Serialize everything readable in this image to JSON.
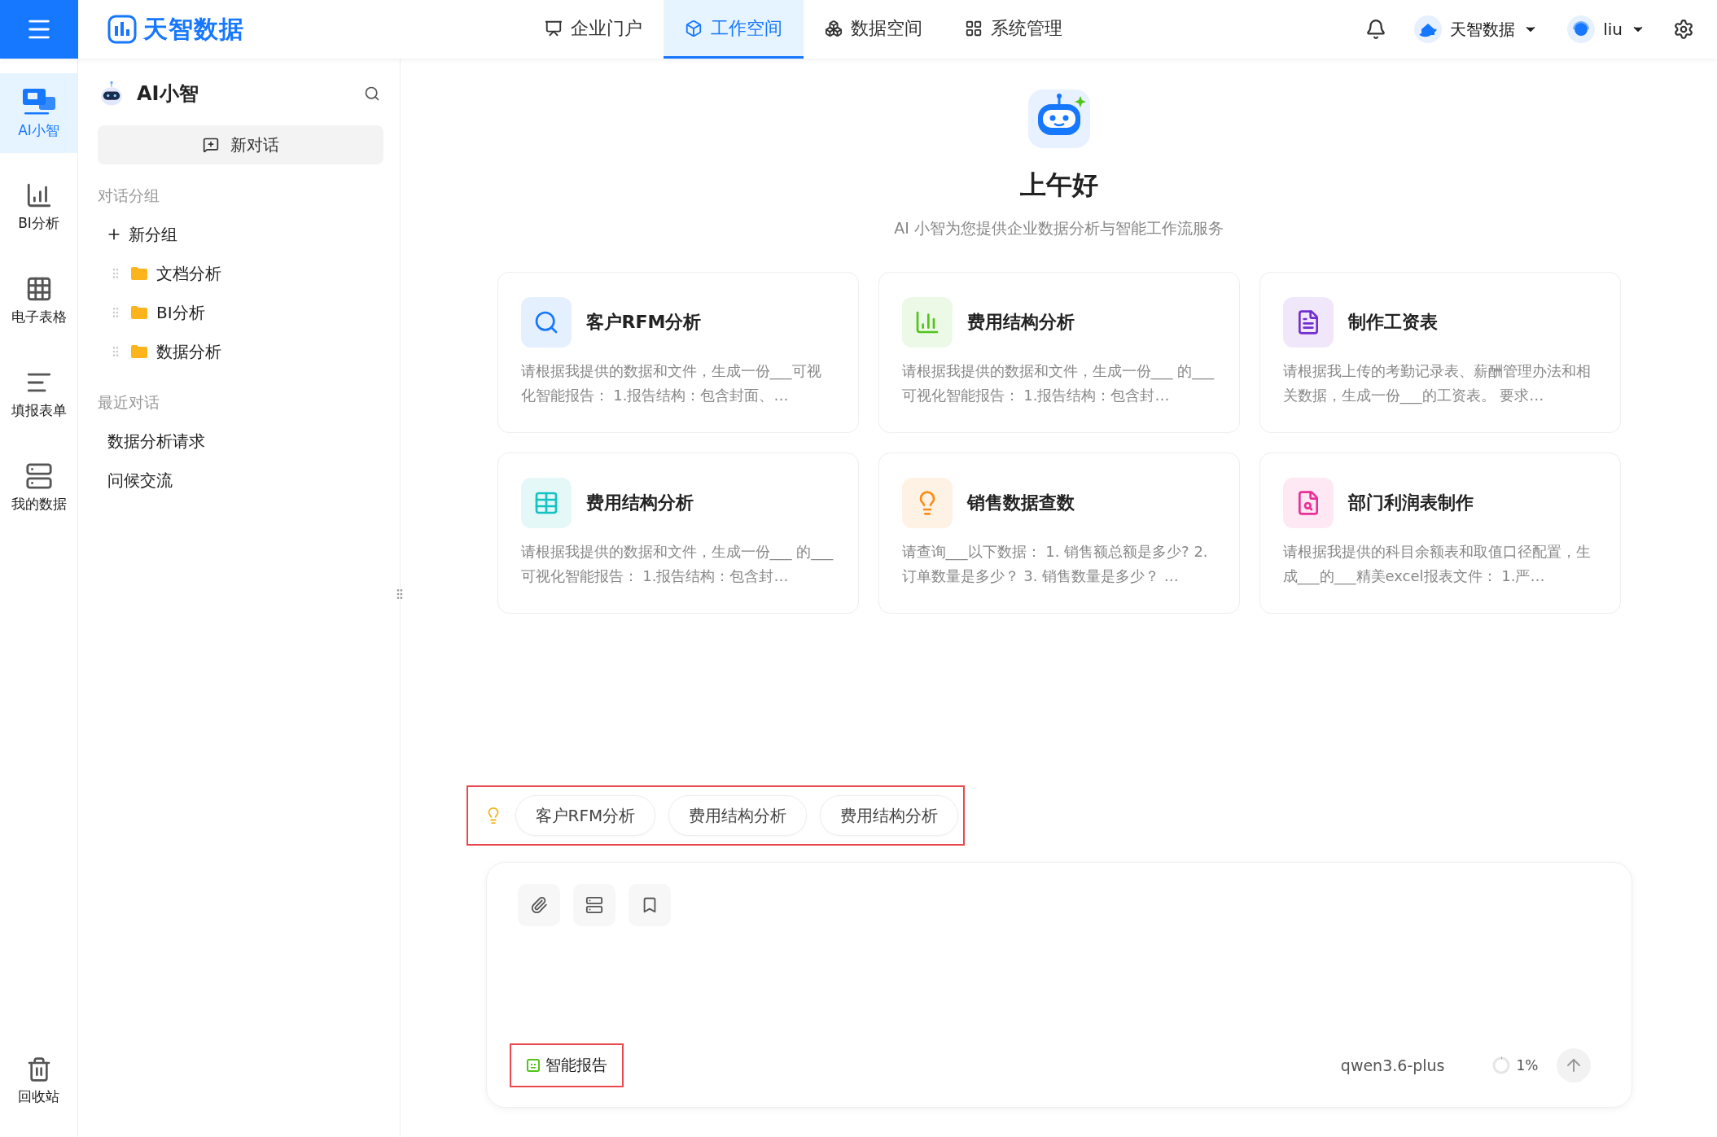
{
  "topbar": {
    "logo_text": "天智数据",
    "nav": [
      {
        "label": "企业门户",
        "selected": false
      },
      {
        "label": "工作空间",
        "selected": true
      },
      {
        "label": "数据空间",
        "selected": false
      },
      {
        "label": "系统管理",
        "selected": false
      }
    ],
    "org": "天智数据",
    "user": "liu"
  },
  "rail": {
    "items": [
      {
        "label": "AI小智",
        "selected": true
      },
      {
        "label": "BI分析",
        "selected": false
      },
      {
        "label": "电子表格",
        "selected": false
      },
      {
        "label": "填报表单",
        "selected": false
      },
      {
        "label": "我的数据",
        "selected": false
      }
    ],
    "footer": {
      "label": "回收站"
    }
  },
  "sidebar": {
    "title": "AI小智",
    "new_chat": "新对话",
    "groups_heading": "对话分组",
    "add_group": "新分组",
    "groups": [
      {
        "label": "文档分析"
      },
      {
        "label": "BI分析"
      },
      {
        "label": "数据分析"
      }
    ],
    "recent_heading": "最近对话",
    "recent": [
      {
        "label": "数据分析请求"
      },
      {
        "label": "问候交流"
      }
    ]
  },
  "welcome": {
    "greeting": "上午好",
    "subtitle": "AI 小智为您提供企业数据分析与智能工作流服务"
  },
  "cards": [
    {
      "title": "客户RFM分析",
      "desc": "请根据我提供的数据和文件，生成一份___可视化智能报告： 1.报告结构：包含封面、…",
      "color": "#1677ff"
    },
    {
      "title": "费用结构分析",
      "desc": "请根据我提供的数据和文件，生成一份___ 的___可视化智能报告： 1.报告结构：包含封…",
      "color": "#52c41a"
    },
    {
      "title": "制作工资表",
      "desc": "请根据我上传的考勤记录表、薪酬管理办法和相关数据，生成一份___的工资表。 要求…",
      "color": "#722ed1"
    },
    {
      "title": "费用结构分析",
      "desc": "请根据我提供的数据和文件，生成一份___ 的___可视化智能报告： 1.报告结构：包含封…",
      "color": "#13c2c2"
    },
    {
      "title": "销售数据查数",
      "desc": "请查询___以下数据： 1. 销售额总额是多少? 2. 订单数量是多少？ 3. 销售数量是多少？ …",
      "color": "#fa8c16"
    },
    {
      "title": "部门利润表制作",
      "desc": "请根据我提供的科目余额表和取值口径配置，生成___的___精美excel报表文件： 1.严…",
      "color": "#eb2f96"
    }
  ],
  "suggestions": [
    {
      "label": "客户RFM分析"
    },
    {
      "label": "费用结构分析"
    },
    {
      "label": "费用结构分析"
    }
  ],
  "composer": {
    "mode": "智能报告",
    "model": "qwen3.6-plus",
    "usage": {
      "level": 0.01,
      "reading": "1%"
    }
  }
}
